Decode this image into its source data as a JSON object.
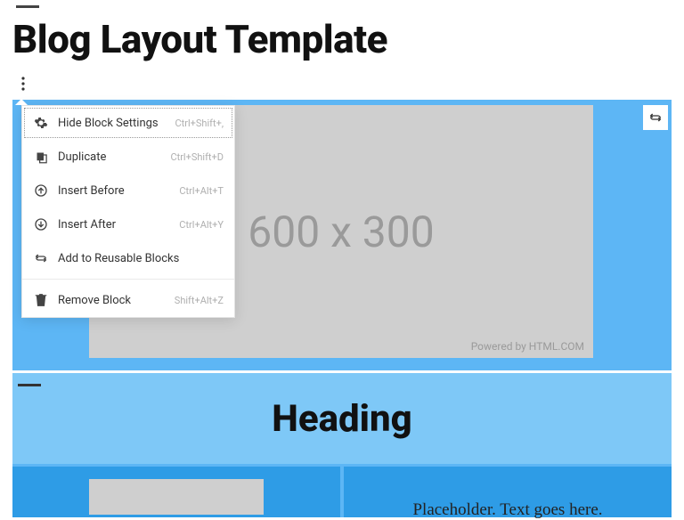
{
  "page": {
    "title": "Blog Layout Template"
  },
  "placeholder": {
    "dimensions": "600 x 300",
    "credit": "Powered by HTML.COM"
  },
  "section": {
    "heading": "Heading",
    "col_text": "Placeholder. Text goes here."
  },
  "menu": {
    "items": [
      {
        "icon": "gear-icon",
        "label": "Hide Block Settings",
        "shortcut": "Ctrl+Shift+,"
      },
      {
        "icon": "copy-icon",
        "label": "Duplicate",
        "shortcut": "Ctrl+Shift+D"
      },
      {
        "icon": "before-icon",
        "label": "Insert Before",
        "shortcut": "Ctrl+Alt+T"
      },
      {
        "icon": "after-icon",
        "label": "Insert After",
        "shortcut": "Ctrl+Alt+Y"
      },
      {
        "icon": "loop-icon",
        "label": "Add to Reusable Blocks",
        "shortcut": ""
      },
      {
        "icon": "trash-icon",
        "label": "Remove Block",
        "shortcut": "Shift+Alt+Z"
      }
    ]
  }
}
